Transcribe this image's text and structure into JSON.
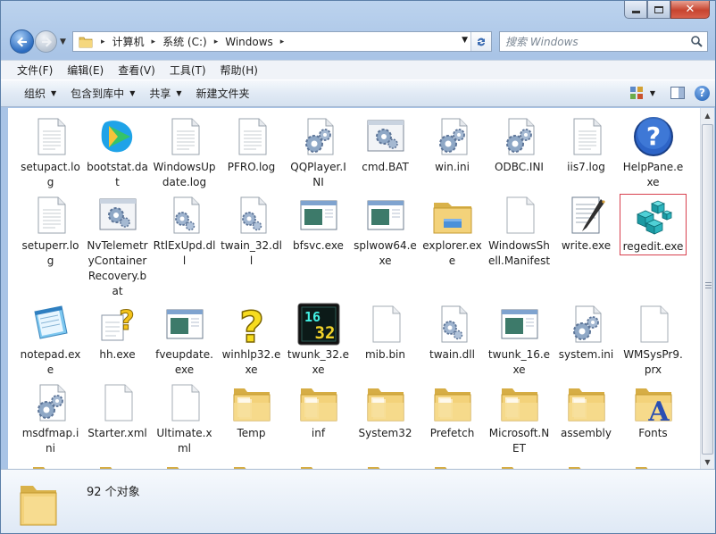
{
  "window": {
    "controls": {
      "minimize": "–",
      "maximize": "□",
      "close": "✕"
    }
  },
  "address": {
    "crumbs": [
      "计算机",
      "系统 (C:)",
      "Windows"
    ],
    "search_placeholder": "搜索 Windows"
  },
  "menu": [
    "文件(F)",
    "编辑(E)",
    "查看(V)",
    "工具(T)",
    "帮助(H)"
  ],
  "commands": [
    {
      "label": "组织",
      "dropdown": true
    },
    {
      "label": "包含到库中",
      "dropdown": true
    },
    {
      "label": "共享",
      "dropdown": true
    },
    {
      "label": "新建文件夹",
      "dropdown": false
    }
  ],
  "files": [
    {
      "name": "setupact.log",
      "icon": "text-file-icon"
    },
    {
      "name": "bootstat.dat",
      "icon": "media-player-icon"
    },
    {
      "name": "WindowsUpdate.log",
      "icon": "text-file-icon"
    },
    {
      "name": "PFRO.log",
      "icon": "text-file-icon"
    },
    {
      "name": "QQPlayer.INI",
      "icon": "settings-file-icon"
    },
    {
      "name": "cmd.BAT",
      "icon": "batch-file-icon"
    },
    {
      "name": "win.ini",
      "icon": "settings-file-icon"
    },
    {
      "name": "ODBC.INI",
      "icon": "settings-file-icon"
    },
    {
      "name": "iis7.log",
      "icon": "text-file-icon"
    },
    {
      "name": "HelpPane.exe",
      "icon": "help-icon"
    },
    {
      "name": "setuperr.log",
      "icon": "text-file-icon"
    },
    {
      "name": "NvTelemetryContainerRecovery.bat",
      "icon": "batch-file-icon"
    },
    {
      "name": "RtlExUpd.dll",
      "icon": "dll-file-icon"
    },
    {
      "name": "twain_32.dll",
      "icon": "dll-file-icon"
    },
    {
      "name": "bfsvc.exe",
      "icon": "app-window-icon"
    },
    {
      "name": "splwow64.exe",
      "icon": "app-window-icon"
    },
    {
      "name": "explorer.exe",
      "icon": "explorer-folder-icon"
    },
    {
      "name": "WindowsShell.Manifest",
      "icon": "blank-file-icon"
    },
    {
      "name": "write.exe",
      "icon": "wordpad-icon"
    },
    {
      "name": "regedit.exe",
      "icon": "registry-editor-icon",
      "selected": true
    },
    {
      "name": "notepad.exe",
      "icon": "notepad-icon"
    },
    {
      "name": "hh.exe",
      "icon": "help-document-icon"
    },
    {
      "name": "fveupdate.exe",
      "icon": "app-window-icon"
    },
    {
      "name": "winhlp32.exe",
      "icon": "question-mark-icon"
    },
    {
      "name": "twunk_32.exe",
      "icon": "twunk-16-32-icon",
      "badge": "16 32"
    },
    {
      "name": "mib.bin",
      "icon": "blank-file-icon"
    },
    {
      "name": "twain.dll",
      "icon": "dll-file-icon"
    },
    {
      "name": "twunk_16.exe",
      "icon": "app-window-icon"
    },
    {
      "name": "system.ini",
      "icon": "settings-file-icon"
    },
    {
      "name": "WMSysPr9.prx",
      "icon": "blank-file-icon"
    },
    {
      "name": "msdfmap.ini",
      "icon": "settings-file-icon"
    },
    {
      "name": "Starter.xml",
      "icon": "blank-file-icon"
    },
    {
      "name": "Ultimate.xml",
      "icon": "blank-file-icon"
    },
    {
      "name": "Temp",
      "icon": "folder-icon"
    },
    {
      "name": "inf",
      "icon": "folder-icon"
    },
    {
      "name": "System32",
      "icon": "folder-icon"
    },
    {
      "name": "Prefetch",
      "icon": "folder-icon"
    },
    {
      "name": "Microsoft.NET",
      "icon": "folder-icon"
    },
    {
      "name": "assembly",
      "icon": "folder-icon"
    },
    {
      "name": "Fonts",
      "icon": "fonts-folder-icon"
    }
  ],
  "status": {
    "count_text": "92 个对象"
  },
  "colors": {
    "selection_border": "#d8404e",
    "folder": "#f3d27a"
  }
}
